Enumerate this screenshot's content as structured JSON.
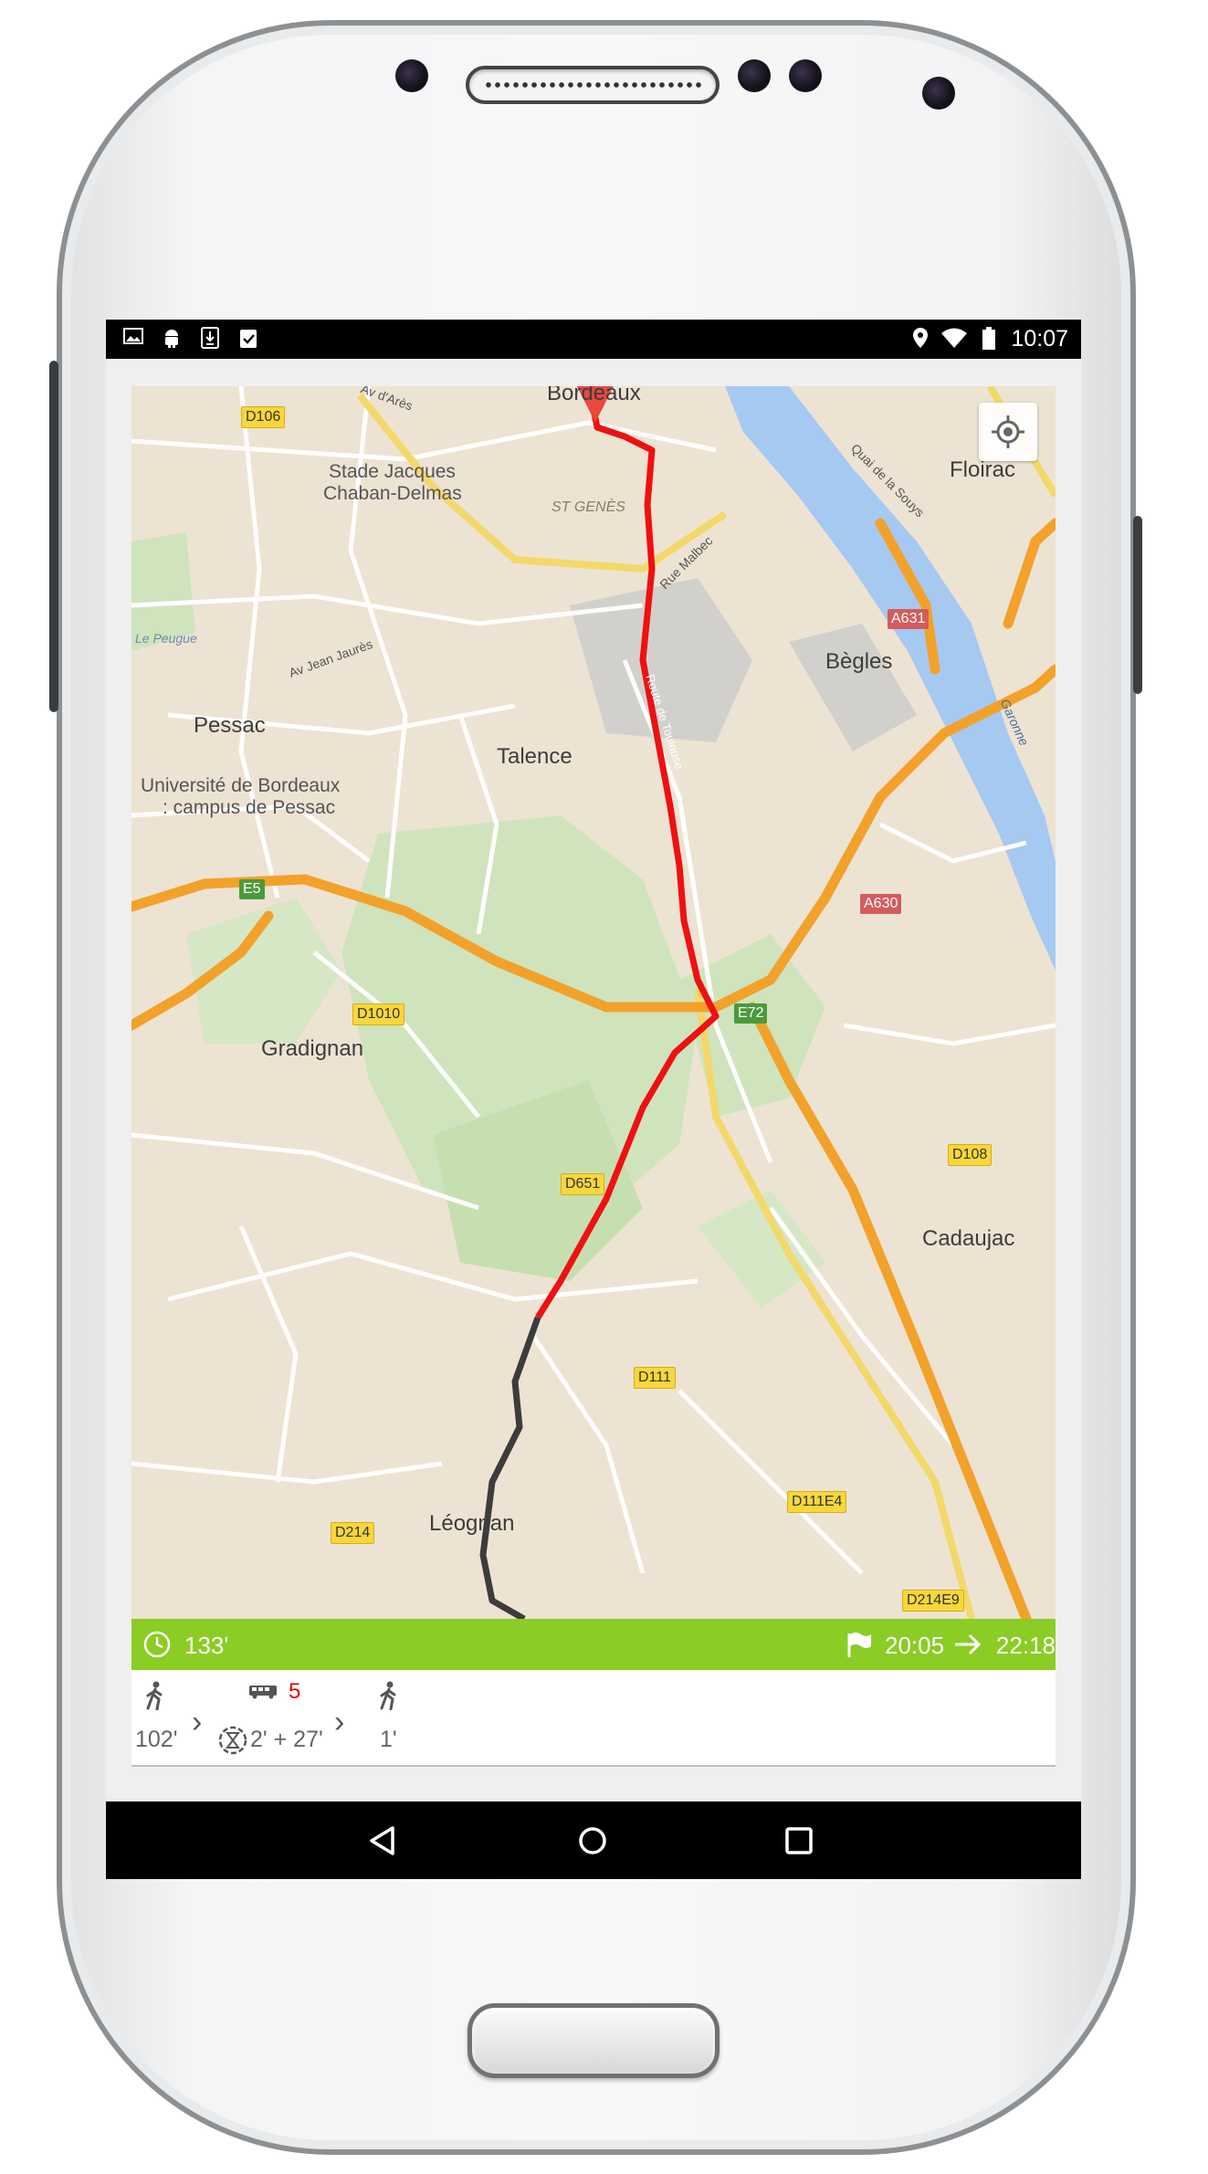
{
  "status_bar": {
    "time": "10:07",
    "left_icons": [
      "image-icon",
      "android-icon",
      "download-icon",
      "clipboard-check-icon"
    ],
    "right_icons": [
      "location-pin-icon",
      "wifi-icon",
      "battery-icon"
    ]
  },
  "map": {
    "labels": {
      "bordeaux": "Bordeaux",
      "floirac": "Floirac",
      "stade": "Stade Jacques",
      "stade2": "Chaban-Delmas",
      "st_genes": "ST GENÈS",
      "begles": "Bègles",
      "pessac": "Pessac",
      "talence": "Talence",
      "univ1": "Université de Bordeaux",
      "univ2": ": campus de Pessac",
      "gradignan": "Gradignan",
      "cadaujac": "Cadaujac",
      "leognan": "Léognan",
      "rue_malbec": "Rue Malbec",
      "av_jean_jaures": "Av Jean Jaurès",
      "peugue": "Le Peugue",
      "av_ares": "Av d'Arès",
      "quai": "Quai de la Souys",
      "garonne": "Garonne",
      "route_toulouse": "Route de Toulouse"
    },
    "road_shields": {
      "d106": "D106",
      "a631": "A631",
      "e5": "E5",
      "a630": "A630",
      "d1010": "D1010",
      "e72": "E72",
      "d108": "D108",
      "d651": "D651",
      "d111": "D111",
      "d111e4": "D111E4",
      "d214": "D214",
      "d214e9": "D214E9"
    },
    "route_colors": {
      "driving": "#ee1111",
      "walking": "#3c3c3c"
    }
  },
  "trip": {
    "duration": "133'",
    "depart": "20:05",
    "arrive": "22:18",
    "steps": [
      {
        "icon": "walk-icon",
        "label": "102'"
      },
      {
        "icon": "bus-icon",
        "line": "5",
        "label": "2' + 27'"
      },
      {
        "icon": "walk-icon",
        "label": "1'"
      }
    ]
  },
  "colors": {
    "accent": "#8bcc25",
    "line_red": "#e00000"
  }
}
